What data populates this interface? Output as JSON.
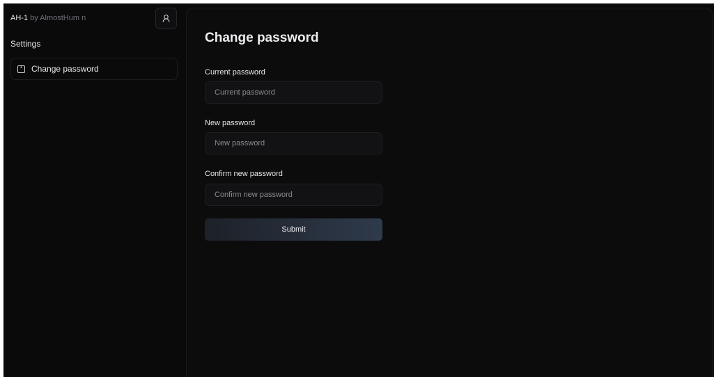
{
  "sidebar": {
    "brand": {
      "name": "AH-1",
      "suffix": " by AlmostHum  n"
    },
    "user_button_icon": "user-icon",
    "section_title": "Settings",
    "items": [
      {
        "label": "Change password",
        "icon": "asterisk-square-icon",
        "icon_glyph": "*"
      }
    ]
  },
  "main": {
    "title": "Change password",
    "fields": [
      {
        "label": "Current password",
        "placeholder": "Current password",
        "value": ""
      },
      {
        "label": "New password",
        "placeholder": "New password",
        "value": ""
      },
      {
        "label": "Confirm new password",
        "placeholder": "Confirm new password",
        "value": ""
      }
    ],
    "submit_label": "Submit"
  },
  "colors": {
    "background": "#0a0a0b",
    "panel": "#0c0c0d",
    "border": "#1f1f22",
    "text": "#e6e6e8",
    "muted": "#6f7077",
    "button_gradient_start": "#1d2128",
    "button_gradient_end": "#2f3a4b"
  }
}
